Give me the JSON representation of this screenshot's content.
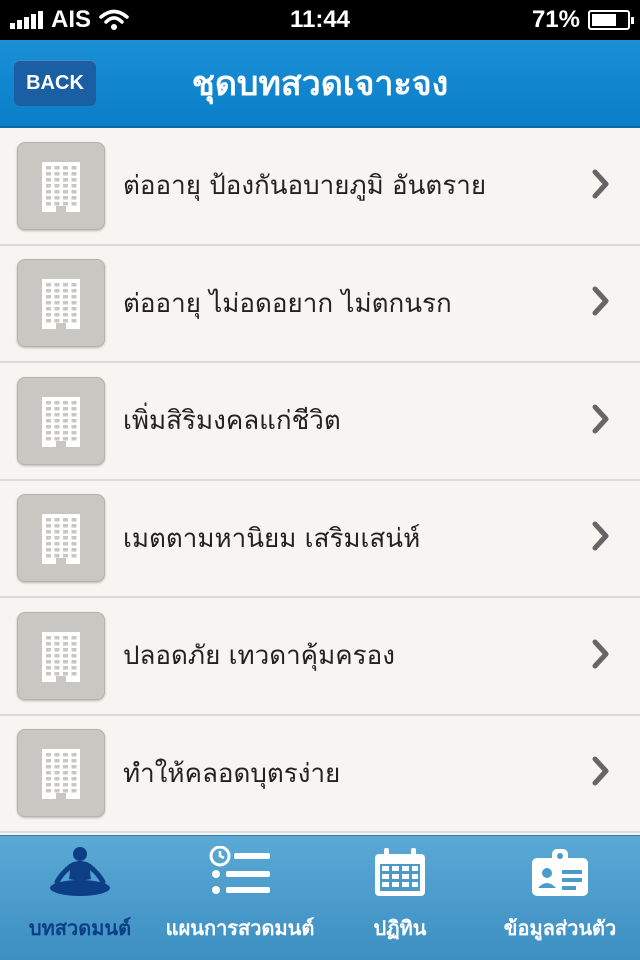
{
  "status": {
    "carrier": "AIS",
    "time": "11:44",
    "battery_text": "71%",
    "battery_level": 0.71
  },
  "nav": {
    "back_label": "BACK",
    "title": "ชุดบทสวดเจาะจง"
  },
  "list": {
    "thumb_icon": "building-icon",
    "chevron_icon": "chevron-right-icon",
    "items": [
      {
        "label": "ต่ออายุ ป้องกันอบายภูมิ อันตราย"
      },
      {
        "label": "ต่ออายุ ไม่อดอยาก ไม่ตกนรก"
      },
      {
        "label": "เพิ่มสิริมงคลแก่ชีวิต"
      },
      {
        "label": "เมตตามหานิยม เสริมเสน่ห์"
      },
      {
        "label": "ปลอดภัย เทวดาคุ้มครอง"
      },
      {
        "label": "ทำให้คลอดบุตรง่าย"
      }
    ]
  },
  "tabs": [
    {
      "label": "บทสวดมนต์",
      "icon": "meditation-icon",
      "active": true
    },
    {
      "label": "แผนการสวดมนต์",
      "icon": "schedule-list-icon",
      "active": false
    },
    {
      "label": "ปฏิทิน",
      "icon": "calendar-icon",
      "active": false
    },
    {
      "label": "ข้อมูลส่วนตัว",
      "icon": "id-card-icon",
      "active": false
    }
  ],
  "colors": {
    "nav_blue": "#0a7ec8",
    "back_button": "#1a5ea3",
    "tab_bar": "#4a9bcc",
    "active_tab": "#0d3f86",
    "thumb_gray": "#c9c7c2"
  }
}
